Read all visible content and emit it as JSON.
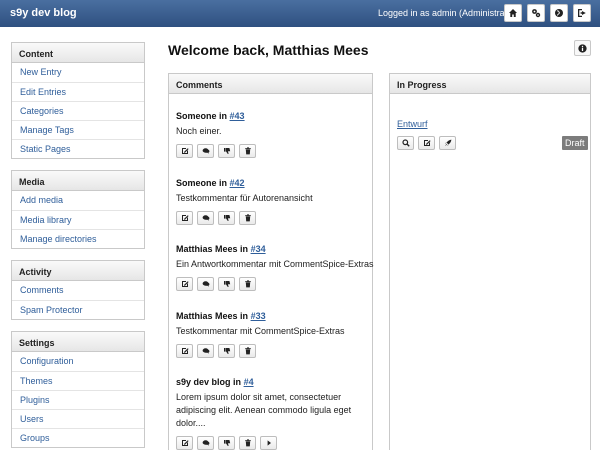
{
  "header": {
    "brand": "s9y dev blog",
    "login_info": "Logged in as admin (Administrator)"
  },
  "sidebar": {
    "sections": [
      {
        "title": "Content",
        "items": [
          "New Entry",
          "Edit Entries",
          "Categories",
          "Manage Tags",
          "Static Pages"
        ]
      },
      {
        "title": "Media",
        "items": [
          "Add media",
          "Media library",
          "Manage directories"
        ]
      },
      {
        "title": "Activity",
        "items": [
          "Comments",
          "Spam Protector"
        ]
      },
      {
        "title": "Settings",
        "items": [
          "Configuration",
          "Themes",
          "Plugins",
          "Users",
          "Groups"
        ]
      }
    ]
  },
  "main": {
    "welcome": "Welcome back, Matthias Mees",
    "comments_title": "Comments",
    "comments": [
      {
        "author": "Someone",
        "in": "in",
        "link": "#43",
        "body": "Noch einer."
      },
      {
        "author": "Someone",
        "in": "in",
        "link": "#42",
        "body": "Testkommentar für Autorenansicht"
      },
      {
        "author": "Matthias Mees",
        "in": "in",
        "link": "#34",
        "body": "Ein Antwortkommentar mit CommentSpice-Extras"
      },
      {
        "author": "Matthias Mees",
        "in": "in",
        "link": "#33",
        "body": "Testkommentar mit CommentSpice-Extras"
      },
      {
        "author": "s9y dev blog",
        "in": "in",
        "link": "#4",
        "body": "Lorem ipsum dolor sit amet, consectetuer adipiscing elit. Aenean commodo ligula eget dolor...."
      }
    ],
    "in_progress_title": "In Progress",
    "draft_entry": "Entwurf",
    "draft_badge": "Draft"
  }
}
